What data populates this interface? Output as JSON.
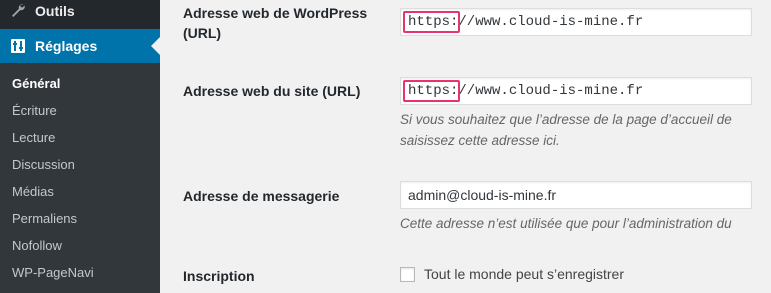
{
  "sidebar": {
    "outils": {
      "label": "Outils",
      "icon": "wrench-icon"
    },
    "reglages": {
      "label": "Réglages",
      "icon": "sliders-icon"
    },
    "submenu": [
      {
        "label": "Général",
        "current": true
      },
      {
        "label": "Écriture"
      },
      {
        "label": "Lecture"
      },
      {
        "label": "Discussion"
      },
      {
        "label": "Médias"
      },
      {
        "label": "Permaliens"
      },
      {
        "label": "Nofollow"
      },
      {
        "label": "WP-PageNavi"
      }
    ]
  },
  "form": {
    "wp_url": {
      "label": "Adresse web de WordPress (URL)",
      "value": "https://www.cloud-is-mine.fr"
    },
    "site_url": {
      "label": "Adresse web du site (URL)",
      "value": "https://www.cloud-is-mine.fr",
      "description_line1": "Si vous souhaitez que l’adresse de la page d’accueil de",
      "description_line2": "saisissez cette adresse ici."
    },
    "email": {
      "label": "Adresse de messagerie",
      "value": "admin@cloud-is-mine.fr",
      "description": "Cette adresse n’est utilisée que pour l’administration du"
    },
    "registration": {
      "label": "Inscription",
      "checkbox_label": "Tout le monde peut s’enregistrer",
      "checked": false
    }
  },
  "colors": {
    "sidebar_bg": "#23282d",
    "submenu_bg": "#32373c",
    "active_menu": "#0073aa",
    "highlight_box": "#e8336d",
    "page_bg": "#f1f1f1"
  }
}
